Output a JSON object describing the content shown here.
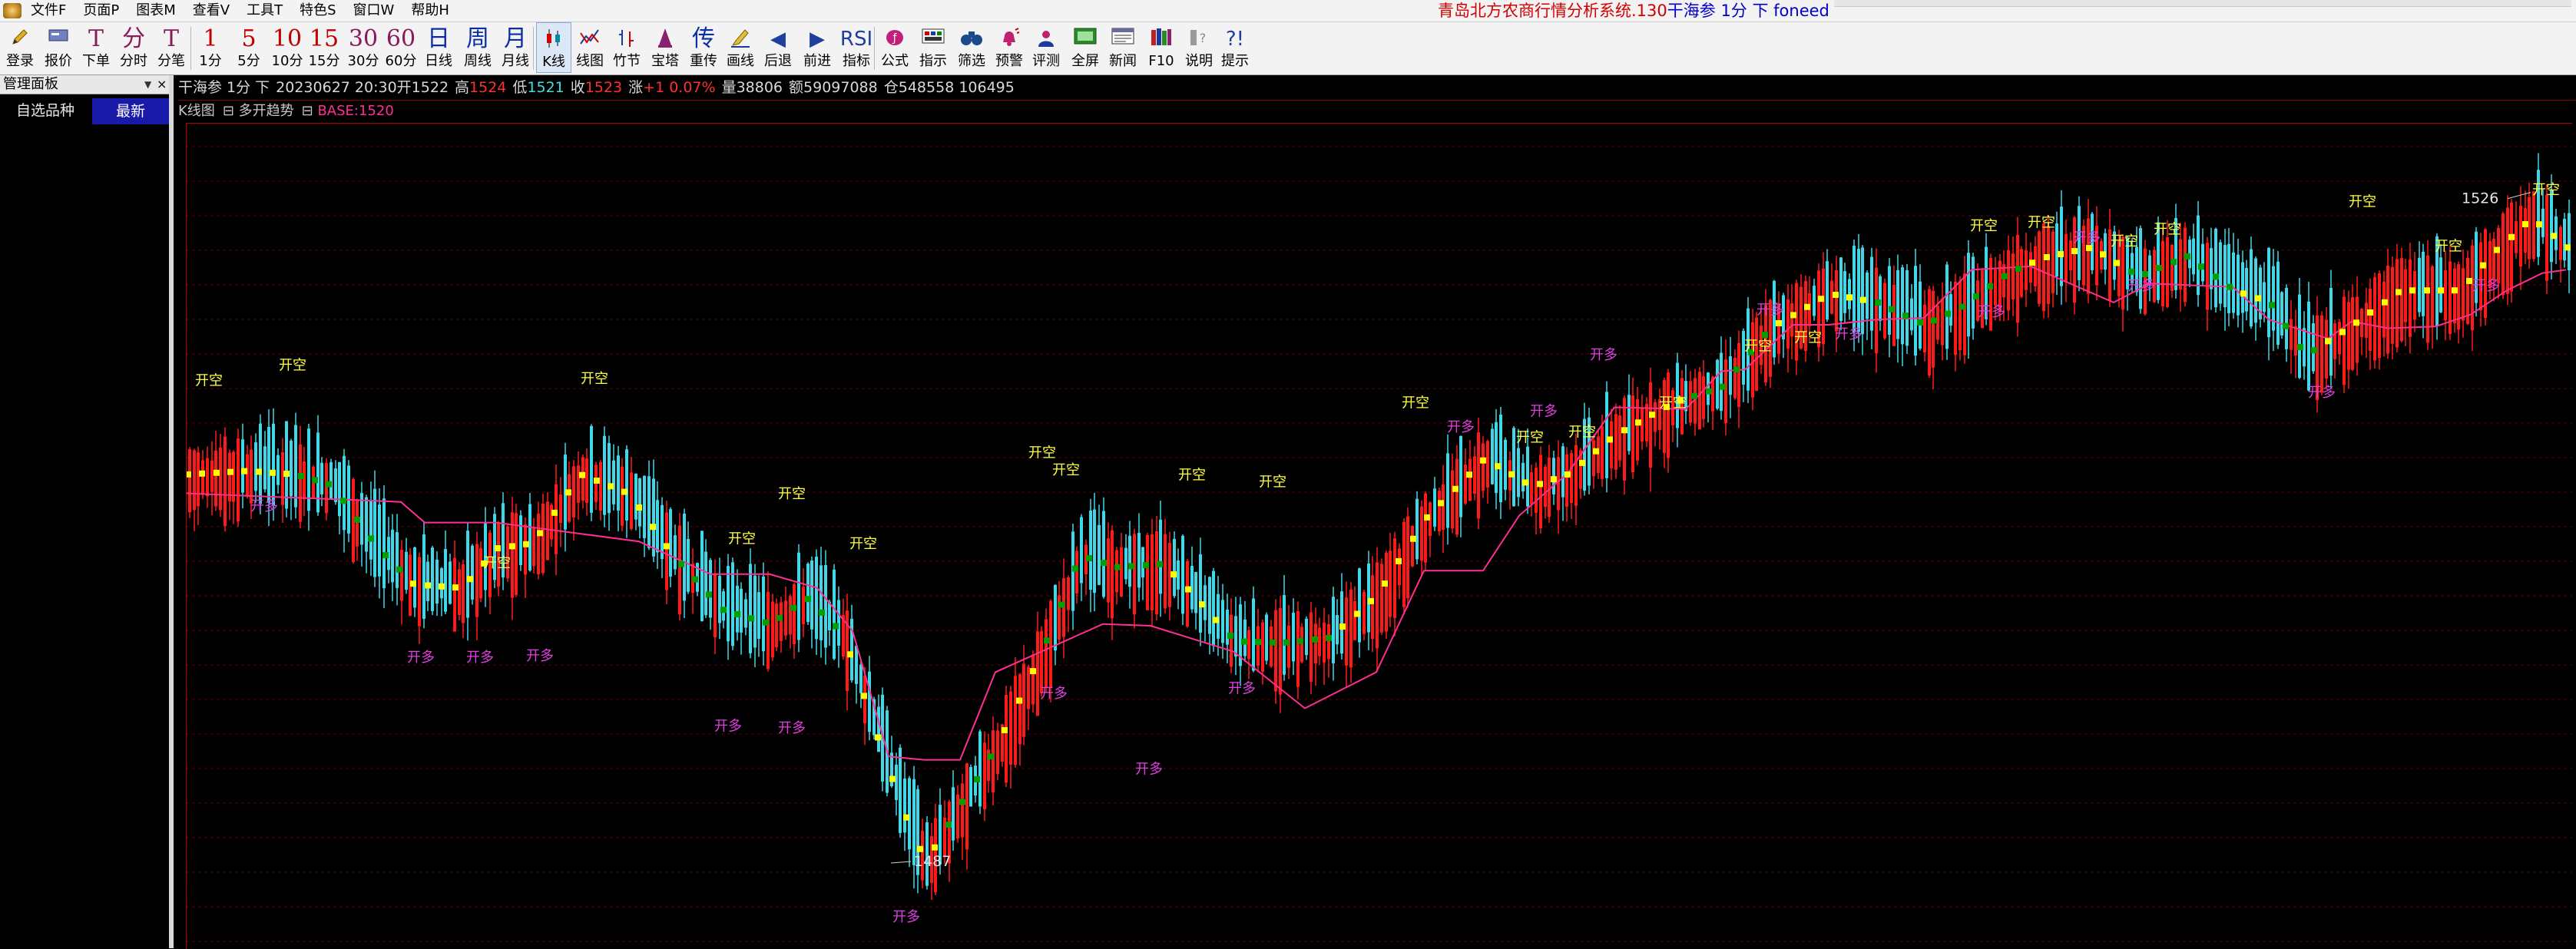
{
  "window": {
    "title_prefix": "青岛北方农商行情分析系统.130",
    "title_suffix": "干海参 1分 下 foneed"
  },
  "menu": [
    "文件F",
    "页面P",
    "图表M",
    "查看V",
    "工具T",
    "特色S",
    "窗口W",
    "帮助H"
  ],
  "toolbar": {
    "buttons": [
      {
        "id": "login",
        "icon": "pencil-icon",
        "label": "登录"
      },
      {
        "id": "quote",
        "icon": "card-icon",
        "label": "报价"
      },
      {
        "id": "order",
        "icon": "order-icon",
        "glyph": "T",
        "label": "下单"
      },
      {
        "id": "intraday",
        "glyph": "分",
        "label": "分时"
      },
      {
        "id": "tick",
        "glyph": "T",
        "label": "分笔"
      },
      {
        "id": "p1",
        "glyph": "1",
        "label": "1分"
      },
      {
        "id": "p5",
        "glyph": "5",
        "label": "5分"
      },
      {
        "id": "p10",
        "glyph": "10",
        "label": "10分"
      },
      {
        "id": "p15",
        "glyph": "15",
        "label": "15分"
      },
      {
        "id": "p30",
        "glyph": "30",
        "label": "30分"
      },
      {
        "id": "p60",
        "glyph": "60",
        "label": "60分"
      },
      {
        "id": "daily",
        "glyph": "日",
        "label": "日线"
      },
      {
        "id": "weekly",
        "glyph": "周",
        "label": "周线"
      },
      {
        "id": "monthly",
        "glyph": "月",
        "label": "月线"
      },
      {
        "id": "kline",
        "icon": "candlestick-icon",
        "label": "K线"
      },
      {
        "id": "line",
        "icon": "line-chart-icon",
        "label": "线图"
      },
      {
        "id": "bamboo",
        "icon": "bamboo-icon",
        "label": "竹节"
      },
      {
        "id": "tower",
        "icon": "tower-icon",
        "label": "宝塔"
      },
      {
        "id": "redraw",
        "glyph": "传",
        "label": "重传"
      },
      {
        "id": "draw",
        "icon": "draw-icon",
        "label": "画线"
      },
      {
        "id": "back",
        "glyph": "◀",
        "label": "后退"
      },
      {
        "id": "forward",
        "glyph": "▶",
        "label": "前进"
      },
      {
        "id": "indicator",
        "glyph": "RSI",
        "label": "指标"
      },
      {
        "id": "formula",
        "icon": "formula-icon",
        "label": "公式"
      },
      {
        "id": "hint",
        "icon": "hint-icon",
        "label": "指示"
      },
      {
        "id": "filter",
        "icon": "binoculars-icon",
        "label": "筛选"
      },
      {
        "id": "alert",
        "icon": "alarm-icon",
        "label": "预警"
      },
      {
        "id": "review",
        "icon": "review-icon",
        "label": "评测"
      },
      {
        "id": "fullscreen",
        "icon": "fullscreen-icon",
        "label": "全屏"
      },
      {
        "id": "news",
        "icon": "news-icon",
        "label": "新闻"
      },
      {
        "id": "f10",
        "icon": "books-icon",
        "label": "F10"
      },
      {
        "id": "help",
        "icon": "help-icon",
        "label": "说明"
      },
      {
        "id": "tips",
        "glyph": "?!",
        "label": "提示"
      }
    ]
  },
  "side_panel": {
    "title": "管理面板",
    "tabs": [
      "自选品种",
      "最新"
    ]
  },
  "quote_bar": {
    "name_period": "干海参 1分 下",
    "datetime_open": "20230627 20:30开1522",
    "high_label": "高",
    "high": "1524",
    "low_label": "低",
    "low": "1521",
    "close_label": "收",
    "close": "1523",
    "change_label": "涨",
    "change": "+1 0.07%",
    "volume": "量38806",
    "amount": "额59097088",
    "open_interest": "仓548558 106495"
  },
  "indicator_bar": {
    "kline_label": "K线图",
    "study_label": "多开趋势",
    "base_label": "BASE:1520"
  },
  "colors": {
    "bull": "#ff1a1a",
    "bear": "#40d8e8",
    "trend_up": "#ffff00",
    "trend_down": "#00a000",
    "base_line": "#ff2f92",
    "signal_short": "#ffff40",
    "signal_long": "#e040e0",
    "grid": "#7a0000"
  },
  "chart_data": {
    "type": "candlestick",
    "symbol": "干海参",
    "period": "1分",
    "ylim": [
      1482,
      1530
    ],
    "price_labels": [
      {
        "text": "1526",
        "value": 1526,
        "at": 0.985
      },
      {
        "text": "1487",
        "value": 1487,
        "at": 0.296
      }
    ],
    "signal_labels": {
      "short": "开空",
      "long": "开多"
    },
    "short_signals": [
      {
        "at": 0.003,
        "price": 1514.8
      },
      {
        "at": 0.038,
        "price": 1515.7
      },
      {
        "at": 0.165,
        "price": 1514.9
      },
      {
        "at": 0.124,
        "price": 1504.2
      },
      {
        "at": 0.248,
        "price": 1508.2
      },
      {
        "at": 0.227,
        "price": 1505.6
      },
      {
        "at": 0.278,
        "price": 1505.3
      },
      {
        "at": 0.353,
        "price": 1510.6
      },
      {
        "at": 0.363,
        "price": 1509.6
      },
      {
        "at": 0.416,
        "price": 1509.3
      },
      {
        "at": 0.45,
        "price": 1508.9
      },
      {
        "at": 0.51,
        "price": 1513.5
      },
      {
        "at": 0.558,
        "price": 1511.5
      },
      {
        "at": 0.58,
        "price": 1511.8
      },
      {
        "at": 0.618,
        "price": 1513.5
      },
      {
        "at": 0.654,
        "price": 1516.8
      },
      {
        "at": 0.675,
        "price": 1517.3
      },
      {
        "at": 0.749,
        "price": 1523.8
      },
      {
        "at": 0.773,
        "price": 1524.0
      },
      {
        "at": 0.808,
        "price": 1522.9
      },
      {
        "at": 0.826,
        "price": 1523.6
      },
      {
        "at": 0.908,
        "price": 1525.2
      },
      {
        "at": 0.944,
        "price": 1522.6
      },
      {
        "at": 0.985,
        "price": 1525.9
      }
    ],
    "long_signals": [
      {
        "at": 0.026,
        "price": 1507.5
      },
      {
        "at": 0.092,
        "price": 1498.7
      },
      {
        "at": 0.117,
        "price": 1498.7
      },
      {
        "at": 0.142,
        "price": 1498.8
      },
      {
        "at": 0.221,
        "price": 1494.7
      },
      {
        "at": 0.248,
        "price": 1494.6
      },
      {
        "at": 0.296,
        "price": 1483.6
      },
      {
        "at": 0.358,
        "price": 1496.6
      },
      {
        "at": 0.398,
        "price": 1492.2
      },
      {
        "at": 0.437,
        "price": 1496.9
      },
      {
        "at": 0.529,
        "price": 1512.1
      },
      {
        "at": 0.564,
        "price": 1513.0
      },
      {
        "at": 0.589,
        "price": 1516.3
      },
      {
        "at": 0.659,
        "price": 1518.9
      },
      {
        "at": 0.692,
        "price": 1517.5
      },
      {
        "at": 0.752,
        "price": 1518.8
      },
      {
        "at": 0.792,
        "price": 1523.1
      },
      {
        "at": 0.815,
        "price": 1520.3
      },
      {
        "at": 0.891,
        "price": 1514.1
      },
      {
        "at": 0.96,
        "price": 1520.3
      }
    ],
    "price_path": [
      [
        0.0,
        1509.6
      ],
      [
        0.025,
        1509.8
      ],
      [
        0.045,
        1509.6
      ],
      [
        0.06,
        1509.0
      ],
      [
        0.08,
        1505.3
      ],
      [
        0.095,
        1503.2
      ],
      [
        0.115,
        1503.0
      ],
      [
        0.13,
        1505.3
      ],
      [
        0.145,
        1505.6
      ],
      [
        0.165,
        1509.6
      ],
      [
        0.185,
        1508.5
      ],
      [
        0.205,
        1504.7
      ],
      [
        0.225,
        1501.7
      ],
      [
        0.245,
        1500.9
      ],
      [
        0.26,
        1502.4
      ],
      [
        0.275,
        1500.4
      ],
      [
        0.3,
        1490.2
      ],
      [
        0.31,
        1487.1
      ],
      [
        0.34,
        1493.8
      ],
      [
        0.36,
        1499.6
      ],
      [
        0.375,
        1504.9
      ],
      [
        0.39,
        1504.2
      ],
      [
        0.41,
        1504.4
      ],
      [
        0.425,
        1502.2
      ],
      [
        0.44,
        1499.9
      ],
      [
        0.46,
        1499.8
      ],
      [
        0.48,
        1500.1
      ],
      [
        0.5,
        1502.6
      ],
      [
        0.52,
        1507.0
      ],
      [
        0.545,
        1510.5
      ],
      [
        0.565,
        1508.9
      ],
      [
        0.58,
        1509.6
      ],
      [
        0.6,
        1511.9
      ],
      [
        0.625,
        1513.8
      ],
      [
        0.645,
        1514.7
      ],
      [
        0.665,
        1518.1
      ],
      [
        0.69,
        1520.1
      ],
      [
        0.71,
        1519.6
      ],
      [
        0.73,
        1518.3
      ],
      [
        0.745,
        1519.3
      ],
      [
        0.765,
        1521.3
      ],
      [
        0.78,
        1522.2
      ],
      [
        0.8,
        1522.8
      ],
      [
        0.82,
        1521.1
      ],
      [
        0.84,
        1522.3
      ],
      [
        0.86,
        1520.3
      ],
      [
        0.875,
        1519.6
      ],
      [
        0.89,
        1516.5
      ],
      [
        0.91,
        1518.3
      ],
      [
        0.93,
        1520.3
      ],
      [
        0.955,
        1520.3
      ],
      [
        0.97,
        1522.6
      ],
      [
        0.985,
        1524.5
      ],
      [
        1.0,
        1522.8
      ]
    ],
    "trend_line_downs": [
      [
        0.045,
        0.09
      ],
      [
        0.205,
        0.275
      ],
      [
        0.315,
        0.34
      ],
      [
        0.36,
        0.41
      ],
      [
        0.435,
        0.48
      ],
      [
        0.63,
        0.665
      ],
      [
        0.705,
        0.775
      ],
      [
        0.815,
        0.86
      ],
      [
        0.875,
        0.895
      ]
    ],
    "base_line": [
      [
        0.0,
        1508.5
      ],
      [
        0.09,
        1508.0
      ],
      [
        0.1,
        1506.8
      ],
      [
        0.13,
        1506.8
      ],
      [
        0.19,
        1505.7
      ],
      [
        0.22,
        1503.8
      ],
      [
        0.245,
        1503.8
      ],
      [
        0.265,
        1503.0
      ],
      [
        0.28,
        1500.5
      ],
      [
        0.295,
        1493.2
      ],
      [
        0.31,
        1493.0
      ],
      [
        0.325,
        1493.0
      ],
      [
        0.34,
        1498.1
      ],
      [
        0.385,
        1500.9
      ],
      [
        0.405,
        1500.8
      ],
      [
        0.44,
        1499.3
      ],
      [
        0.47,
        1496.0
      ],
      [
        0.5,
        1498.1
      ],
      [
        0.52,
        1504.0
      ],
      [
        0.545,
        1504.0
      ],
      [
        0.56,
        1507.2
      ],
      [
        0.575,
        1509.0
      ],
      [
        0.58,
        1509.6
      ],
      [
        0.6,
        1513.5
      ],
      [
        0.63,
        1513.4
      ],
      [
        0.645,
        1515.6
      ],
      [
        0.655,
        1515.7
      ],
      [
        0.675,
        1518.3
      ],
      [
        0.69,
        1518.3
      ],
      [
        0.71,
        1518.6
      ],
      [
        0.73,
        1518.7
      ],
      [
        0.75,
        1521.5
      ],
      [
        0.775,
        1521.7
      ],
      [
        0.79,
        1520.8
      ],
      [
        0.81,
        1519.6
      ],
      [
        0.825,
        1520.7
      ],
      [
        0.86,
        1520.5
      ],
      [
        0.875,
        1518.6
      ],
      [
        0.9,
        1517.5
      ],
      [
        0.91,
        1518.5
      ],
      [
        0.925,
        1518.1
      ],
      [
        0.945,
        1518.2
      ],
      [
        0.96,
        1518.9
      ],
      [
        0.975,
        1520.3
      ],
      [
        0.99,
        1521.3
      ],
      [
        1.0,
        1521.5
      ]
    ]
  }
}
